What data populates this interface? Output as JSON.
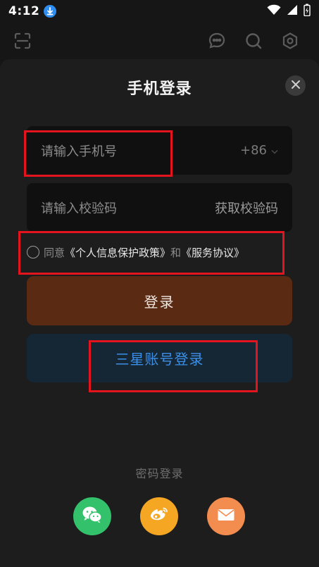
{
  "status_bar": {
    "time": "4:12"
  },
  "dialog": {
    "title": "手机登录"
  },
  "phone_field": {
    "placeholder": "请输入手机号",
    "country_code": "+86"
  },
  "code_field": {
    "placeholder": "请输入校验码",
    "get_code_label": "获取校验码"
  },
  "agreement": {
    "prefix": "同意",
    "privacy_link": "《个人信息保护政策》",
    "connector": "和",
    "service_link": "《服务协议》"
  },
  "buttons": {
    "login_label": "登录",
    "samsung_login_label": "三星账号登录",
    "password_login_label": "密码登录"
  },
  "social_logins": [
    {
      "icon": "wechat-icon",
      "color": "#33c26b"
    },
    {
      "icon": "weibo-icon",
      "color": "#f5a623"
    },
    {
      "icon": "mail-icon",
      "color": "#f28c4f"
    }
  ],
  "colors": {
    "login_button": "#5a2a12",
    "samsung_button": "#152634",
    "samsung_text": "#3d8fe6",
    "annotation_box": "#e4141f"
  }
}
